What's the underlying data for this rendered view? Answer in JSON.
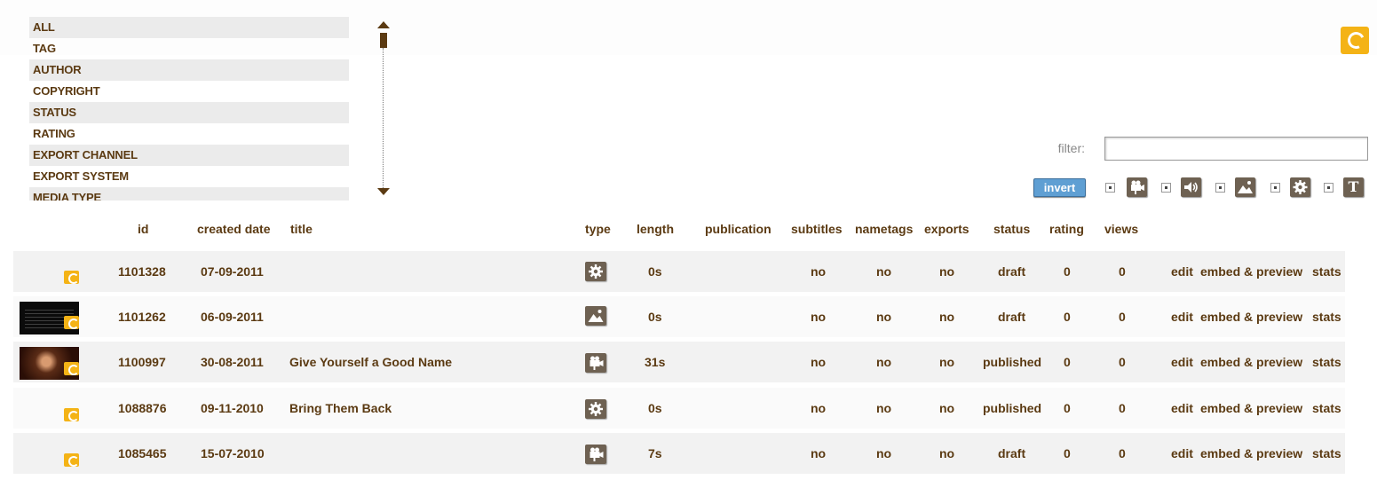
{
  "facets": [
    "ALL",
    "TAG",
    "AUTHOR",
    "COPYRIGHT",
    "STATUS",
    "RATING",
    "EXPORT CHANNEL",
    "EXPORT SYSTEM",
    "MEDIA TYPE"
  ],
  "filter": {
    "label": "filter:",
    "value": "",
    "placeholder": ""
  },
  "invert_label": "invert",
  "type_filters": [
    "video-icon",
    "audio-icon",
    "image-icon",
    "settings-icon",
    "text-icon"
  ],
  "text_filter_glyph": "T",
  "columns": {
    "id": "id",
    "created_date": "created date",
    "title": "title",
    "type": "type",
    "length": "length",
    "publication": "publication",
    "subtitles": "subtitles",
    "nametags": "nametags",
    "exports": "exports",
    "status": "status",
    "rating": "rating",
    "views": "views"
  },
  "rows": [
    {
      "id": "1101328",
      "created_date": "07-09-2011",
      "title": "",
      "type": "settings-icon",
      "length": "0s",
      "publication": "",
      "subtitles": "no",
      "nametags": "no",
      "exports": "no",
      "status": "draft",
      "rating": "0",
      "views": "0",
      "thumbnail": "none",
      "actions": {
        "edit": "edit",
        "embed": "embed & preview",
        "stats": "stats"
      }
    },
    {
      "id": "1101262",
      "created_date": "06-09-2011",
      "title": "",
      "type": "image-icon",
      "length": "0s",
      "publication": "",
      "subtitles": "no",
      "nametags": "no",
      "exports": "no",
      "status": "draft",
      "rating": "0",
      "views": "0",
      "thumbnail": "dark-slide",
      "actions": {
        "edit": "edit",
        "embed": "embed & preview",
        "stats": "stats"
      }
    },
    {
      "id": "1100997",
      "created_date": "30-08-2011",
      "title": "Give Yourself a Good Name",
      "type": "video-icon",
      "length": "31s",
      "publication": "",
      "subtitles": "no",
      "nametags": "no",
      "exports": "no",
      "status": "published",
      "rating": "0",
      "views": "0",
      "thumbnail": "portrait",
      "actions": {
        "edit": "edit",
        "embed": "embed & preview",
        "stats": "stats"
      }
    },
    {
      "id": "1088876",
      "created_date": "09-11-2010",
      "title": "Bring Them Back",
      "type": "settings-icon",
      "length": "0s",
      "publication": "",
      "subtitles": "no",
      "nametags": "no",
      "exports": "no",
      "status": "published",
      "rating": "0",
      "views": "0",
      "thumbnail": "none",
      "actions": {
        "edit": "edit",
        "embed": "embed & preview",
        "stats": "stats"
      }
    },
    {
      "id": "1085465",
      "created_date": "15-07-2010",
      "title": "",
      "type": "video-icon",
      "length": "7s",
      "publication": "",
      "subtitles": "no",
      "nametags": "no",
      "exports": "no",
      "status": "draft",
      "rating": "0",
      "views": "0",
      "thumbnail": "none",
      "actions": {
        "edit": "edit",
        "embed": "embed & preview",
        "stats": "stats"
      }
    }
  ],
  "colors": {
    "accent": "#f4b316",
    "text": "#5b3a12",
    "invert_button": "#5f9fd3",
    "icon_bg": "#6e6152"
  }
}
